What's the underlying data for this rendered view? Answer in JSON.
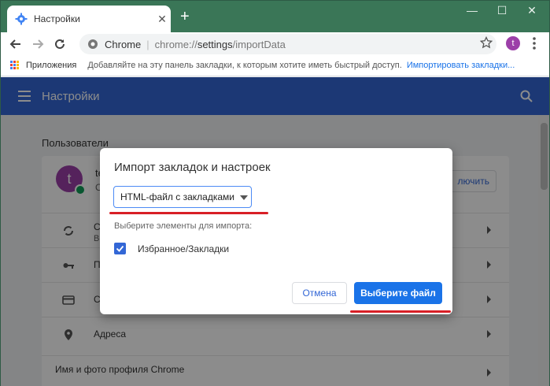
{
  "tab": {
    "title": "Настройки",
    "icon": "gear-icon",
    "close_glyph": "✕"
  },
  "newtab": {
    "glyph": "+"
  },
  "window_controls": {
    "minimize": "—",
    "maximize": "☐",
    "close": "✕"
  },
  "omnibox": {
    "site": "Chrome",
    "separator": "|",
    "url_scheme": "chrome://",
    "url_host": "settings",
    "url_path": "/importData"
  },
  "profile_initial": "t",
  "bookmarks_bar": {
    "apps_label": "Приложения",
    "hint": "Добавляйте на эту панель закладки, к которым хотите иметь быстрый доступ.",
    "import_link": "Импортировать закладки..."
  },
  "settings": {
    "title": "Настройки",
    "section_users": "Пользователи",
    "profile_name": "te",
    "profile_sub": "C",
    "enable_button": "лючить",
    "rows": [
      {
        "label": "С",
        "label2": "В",
        "icon": "sync-icon"
      },
      {
        "label": "П",
        "icon": "key-icon"
      },
      {
        "label": "С",
        "icon": "credit-card-icon"
      },
      {
        "label": "Адреса",
        "icon": "location-pin-icon"
      }
    ],
    "profile_name_row": "Имя и фото профиля Chrome"
  },
  "dialog": {
    "title": "Импорт закладок и настроек",
    "select_value": "HTML-файл с закладками",
    "hint": "Выберите элементы для импорта:",
    "checkbox_label": "Избранное/Закладки",
    "checkbox_checked": true,
    "cancel_label": "Отмена",
    "choose_label": "Выберите файл"
  },
  "colors": {
    "titlebar": "#3a7657",
    "settings_header": "#3367d6",
    "primary_button": "#1a73e8",
    "annotation_red": "#d81f26",
    "avatar": "#9c3fa8"
  }
}
